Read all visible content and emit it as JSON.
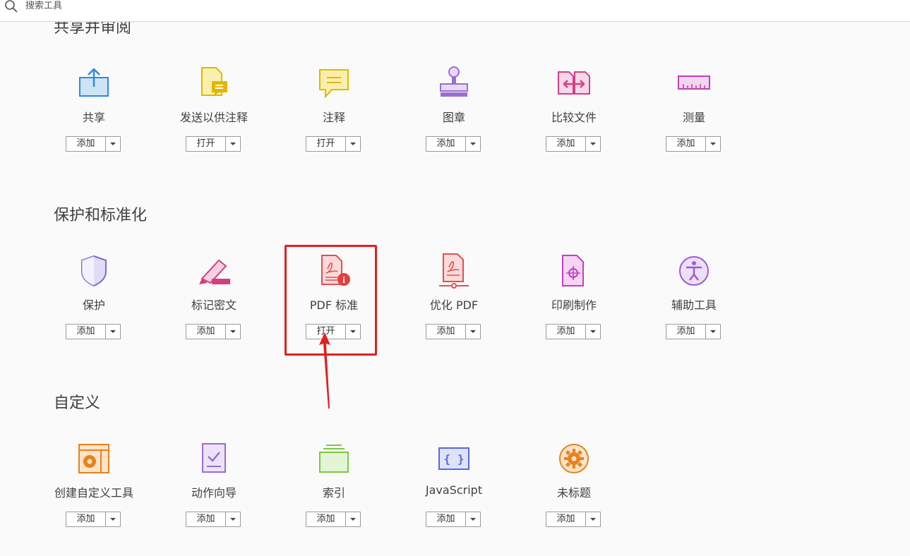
{
  "search": {
    "placeholder": "搜索工具"
  },
  "sections": [
    {
      "title": "共享并审阅"
    },
    {
      "title": "保护和标准化"
    },
    {
      "title": "自定义"
    }
  ],
  "tools": {
    "share": {
      "label": "共享",
      "button": "添加",
      "icon": "share-icon",
      "color": "#2d8ae6"
    },
    "send_comment": {
      "label": "发送以供注释",
      "button": "打开",
      "icon": "send-for-comment-icon",
      "color": "#e0b800"
    },
    "comment": {
      "label": "注释",
      "button": "打开",
      "icon": "comment-icon",
      "color": "#e0b800"
    },
    "stamp": {
      "label": "图章",
      "button": "添加",
      "icon": "stamp-icon",
      "color": "#9b6cd4"
    },
    "compare": {
      "label": "比较文件",
      "button": "添加",
      "icon": "compare-files-icon",
      "color": "#d0408a"
    },
    "measure": {
      "label": "测量",
      "button": "添加",
      "icon": "measure-icon",
      "color": "#c040b0"
    },
    "protect": {
      "label": "保护",
      "button": "添加",
      "icon": "shield-icon",
      "color": "#7a6ad4"
    },
    "redact": {
      "label": "标记密文",
      "button": "添加",
      "icon": "redact-icon",
      "color": "#d04080"
    },
    "pdf_standards": {
      "label": "PDF 标准",
      "button": "打开",
      "icon": "pdf-standards-icon",
      "color": "#e05050"
    },
    "optimize_pdf": {
      "label": "优化 PDF",
      "button": "添加",
      "icon": "optimize-pdf-icon",
      "color": "#e05050"
    },
    "print_production": {
      "label": "印刷制作",
      "button": "添加",
      "icon": "print-production-icon",
      "color": "#c040c0"
    },
    "accessibility": {
      "label": "辅助工具",
      "button": "添加",
      "icon": "accessibility-icon",
      "color": "#9b5cd4"
    },
    "create_custom": {
      "label": "创建自定义工具",
      "button": "添加",
      "icon": "custom-tool-icon",
      "color": "#e8821e"
    },
    "action_wizard": {
      "label": "动作向导",
      "button": "添加",
      "icon": "action-wizard-icon",
      "color": "#9b6cd4"
    },
    "index": {
      "label": "索引",
      "button": "添加",
      "icon": "index-icon",
      "color": "#7ac943"
    },
    "javascript": {
      "label": "JavaScript",
      "button": "添加",
      "icon": "javascript-icon",
      "color": "#5a6ad4"
    },
    "untitled": {
      "label": "未标题",
      "button": "添加",
      "icon": "gear-icon",
      "color": "#e8821e"
    }
  },
  "highlight_color": "#e02020"
}
